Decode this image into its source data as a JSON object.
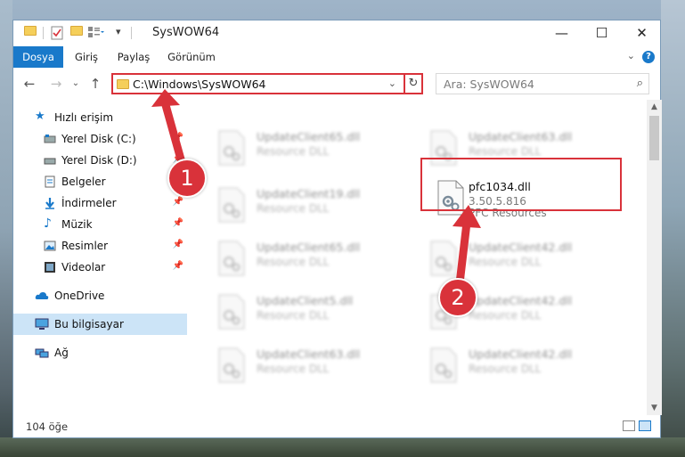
{
  "window": {
    "title": "SysWOW64",
    "controls": {
      "minimize": "—",
      "maximize": "☐",
      "close": "✕"
    }
  },
  "ribbon": {
    "tabs": [
      "Dosya",
      "Giriş",
      "Paylaş",
      "Görünüm"
    ],
    "help": "?"
  },
  "address_bar": {
    "path": "C:\\Windows\\SysWOW64",
    "search_placeholder": "Ara: SysWOW64"
  },
  "sidebar": {
    "items": [
      {
        "label": "Hızlı erişim",
        "icon": "star-icon",
        "pinned": false
      },
      {
        "label": "Yerel Disk (C:)",
        "icon": "drive-icon",
        "pinned": true
      },
      {
        "label": "Yerel Disk (D:)",
        "icon": "drive-icon",
        "pinned": true
      },
      {
        "label": "Belgeler",
        "icon": "documents-icon",
        "pinned": true
      },
      {
        "label": "İndirmeler",
        "icon": "download-icon",
        "pinned": true
      },
      {
        "label": "Müzik",
        "icon": "music-icon",
        "pinned": true
      },
      {
        "label": "Resimler",
        "icon": "pictures-icon",
        "pinned": true
      },
      {
        "label": "Videolar",
        "icon": "videos-icon",
        "pinned": true
      },
      {
        "label": "OneDrive",
        "icon": "cloud-icon",
        "pinned": false
      },
      {
        "label": "Bu bilgisayar",
        "icon": "computer-icon",
        "pinned": false,
        "selected": true
      },
      {
        "label": "Ağ",
        "icon": "network-icon",
        "pinned": false
      }
    ]
  },
  "files": {
    "left": [
      {
        "name": "UpdateClient65.dll",
        "desc": "Resource DLL"
      },
      {
        "name": "UpdateClient19.dll",
        "desc": "Resource DLL"
      },
      {
        "name": "UpdateClient65.dll",
        "desc": "Resource DLL"
      },
      {
        "name": "UpdateClient5.dll",
        "desc": "Resource DLL"
      },
      {
        "name": "UpdateClient63.dll",
        "desc": "Resource DLL"
      }
    ],
    "right": [
      {
        "name": "UpdateClient63.dll",
        "desc": "Resource DLL"
      },
      {
        "name": "UpdateClient42.dll",
        "desc": "Resource DLL"
      },
      {
        "name": "UpdateClient42.dll",
        "desc": "Resource DLL"
      },
      {
        "name": "UpdateClient42.dll",
        "desc": "Resource DLL"
      }
    ],
    "highlighted": {
      "name": "pfc1034.dll",
      "version": "3.50.5.816",
      "desc": "PFC Resources"
    }
  },
  "status": {
    "item_count": "104 öğe"
  },
  "annotations": {
    "step1": "1",
    "step2": "2",
    "color": "#d9323a"
  }
}
